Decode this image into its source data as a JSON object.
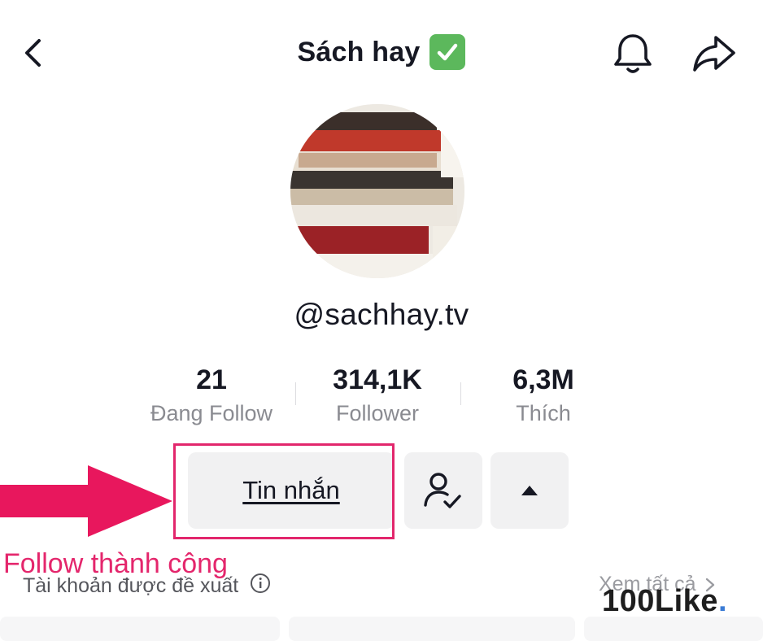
{
  "header": {
    "title": "Sách hay",
    "verified_icon": "check-mark-button-icon",
    "back_icon": "chevron-left-icon",
    "bell_icon": "bell-icon",
    "share_icon": "share-arrow-icon"
  },
  "profile": {
    "avatar_icon": "book-stack-avatar",
    "username": "@sachhay.tv"
  },
  "stats": [
    {
      "value": "21",
      "label": "Đang Follow"
    },
    {
      "value": "314,1K",
      "label": "Follower"
    },
    {
      "value": "6,3M",
      "label": "Thích"
    }
  ],
  "actions": {
    "message_label": "Tin nhắn",
    "friend_icon": "user-check-icon",
    "more_icon": "caret-up-icon"
  },
  "annotation": {
    "note": "Follow thành công",
    "arrow_color": "#e8175d"
  },
  "suggestions": {
    "label": "Tài khoản được đề xuất",
    "see_all": "Xem tất cả"
  },
  "watermark": {
    "text": "100Like",
    "dot": "."
  },
  "colors": {
    "accent": "#e2266c",
    "verified": "#5cb85c",
    "button_bg": "#f1f1f2"
  }
}
